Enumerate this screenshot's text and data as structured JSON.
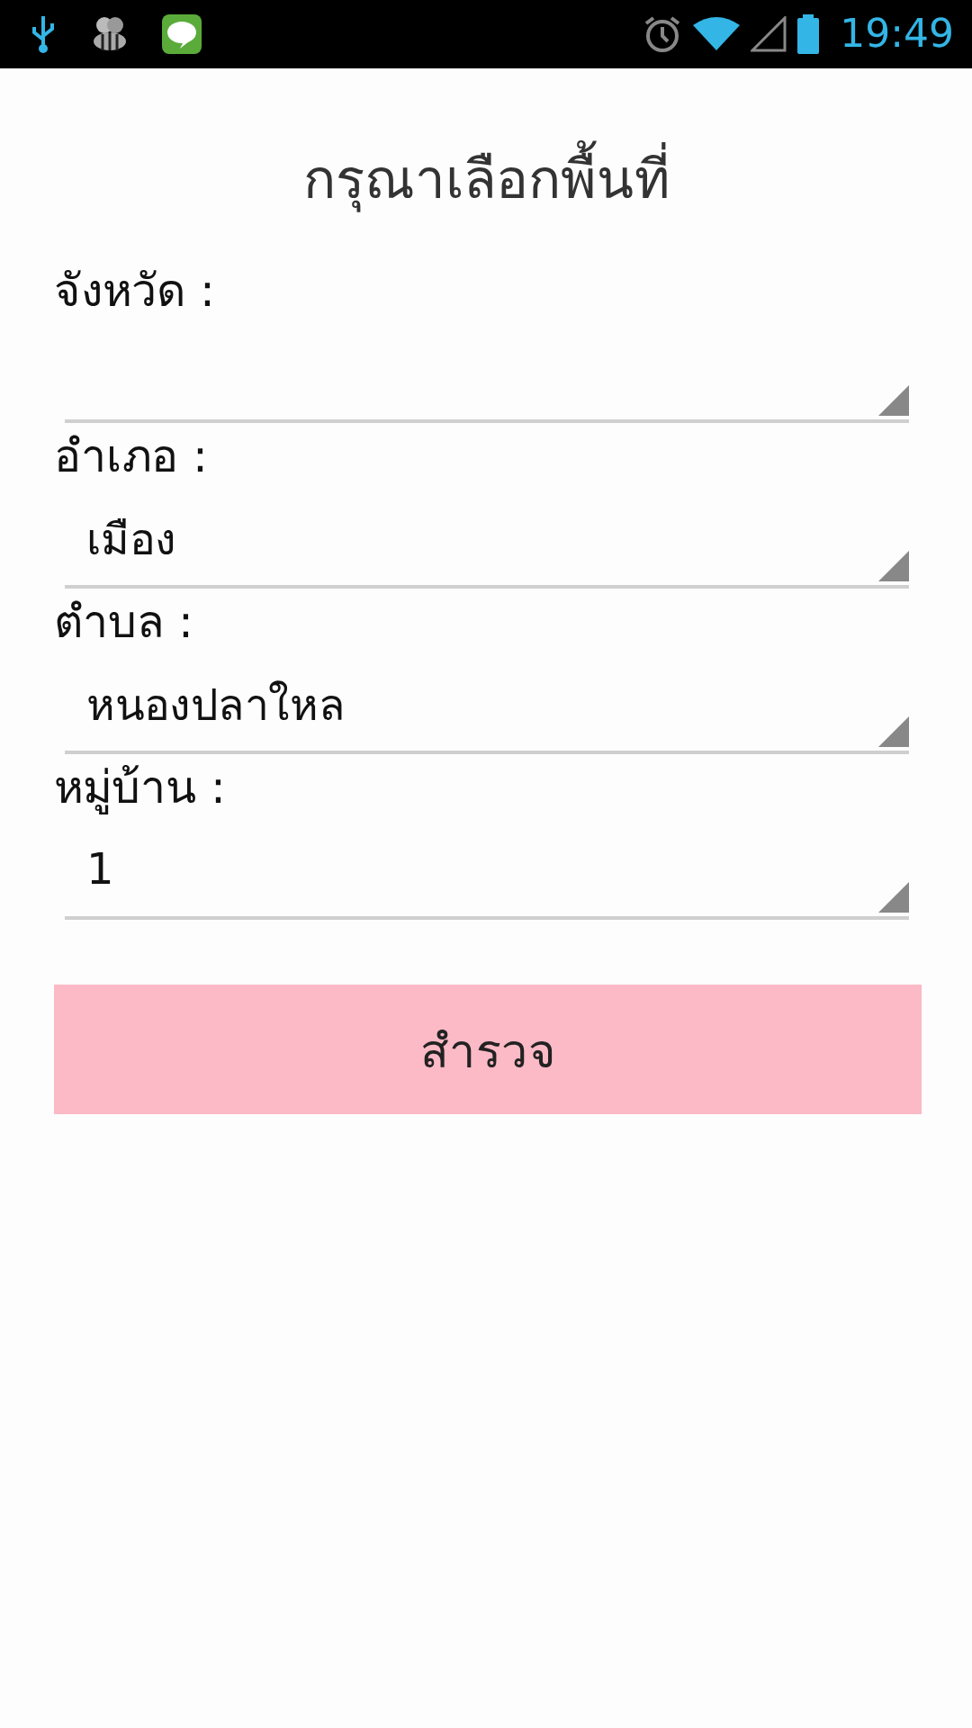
{
  "status_bar": {
    "time": "19:49"
  },
  "title": "กรุณาเลือกพื้นที่",
  "fields": [
    {
      "label": "จังหวัด :"
    },
    {
      "label": "อำเภอ :",
      "value": "เมือง"
    },
    {
      "label": "ตำบล :",
      "value": "หนองปลาใหล"
    },
    {
      "label": "หมู่บ้าน :",
      "value": "1"
    }
  ],
  "button": "สำรวจ"
}
